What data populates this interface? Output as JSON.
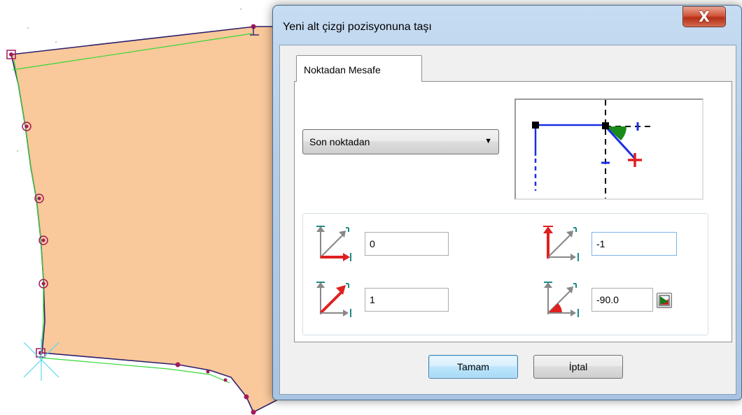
{
  "dialog": {
    "title": "Yeni alt çizgi pozisyonuna taşı",
    "close_label": "X",
    "tabs": [
      {
        "label": "Noktadan Mesafe",
        "selected": true
      }
    ]
  },
  "reference": {
    "selected": "Son noktadan"
  },
  "params": {
    "dx": {
      "value": "0",
      "icon": "x-offset-icon"
    },
    "dy": {
      "value": "-1",
      "icon": "y-offset-icon"
    },
    "length": {
      "value": "1",
      "icon": "length-icon"
    },
    "angle": {
      "value": "-90.0",
      "icon": "angle-icon"
    }
  },
  "buttons": {
    "ok": "Tamam",
    "cancel": "İptal"
  },
  "colors": {
    "piece_fill": "#f9c89b",
    "outline": "#2c1f6b",
    "green_line": "#35d935",
    "point_marker": "#a3195b",
    "accent_red": "#e02020"
  }
}
